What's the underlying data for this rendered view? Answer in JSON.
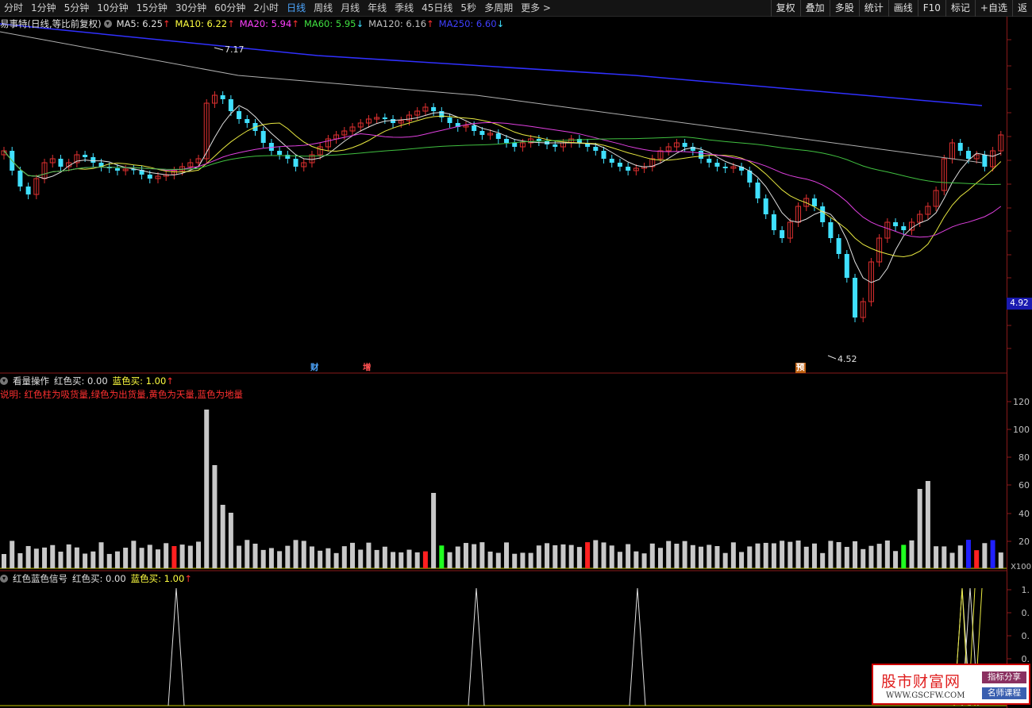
{
  "toolbar": {
    "periods": [
      "分时",
      "1分钟",
      "5分钟",
      "10分钟",
      "15分钟",
      "30分钟",
      "60分钟",
      "2小时",
      "日线",
      "周线",
      "月线",
      "年线",
      "季线",
      "45日线",
      "5秒",
      "多周期",
      "更多 >"
    ],
    "active_period": "日线",
    "actions": [
      "复权",
      "叠加",
      "多股",
      "统计",
      "画线",
      "F10",
      "标记",
      "+自选",
      "返"
    ]
  },
  "main_panel": {
    "stock": "易事特(日线,等比前复权)",
    "ma": [
      {
        "label": "MA5: 6.25",
        "arrow": "↑",
        "color": "#e0e0e0"
      },
      {
        "label": "MA10: 6.22",
        "arrow": "↑",
        "color": "#ffff40"
      },
      {
        "label": "MA20: 5.94",
        "arrow": "↑",
        "color": "#ff40ff"
      },
      {
        "label": "MA60: 5.95",
        "arrow": "↓",
        "color": "#40e040"
      },
      {
        "label": "MA120: 6.16",
        "arrow": "↑",
        "color": "#c0c0c0"
      },
      {
        "label": "MA250: 6.60",
        "arrow": "↓",
        "color": "#4040ff"
      }
    ],
    "high_label": "7.17",
    "low_label": "4.52",
    "current_price": "4.92",
    "events": [
      {
        "text": "财",
        "color": "#4da6ff"
      },
      {
        "text": "增",
        "color": "#ff5050"
      },
      {
        "text": "预",
        "color": "#ffa030"
      }
    ]
  },
  "volume_panel": {
    "title": "看量操作",
    "red_label": "红色买: 0.00",
    "blue_label": "蓝色买: 1.00",
    "blue_arrow": "↑",
    "note": "说明: 红色柱为吸货量,绿色为出货量,黄色为天量,蓝色为地量",
    "unit": "X100",
    "axis": [
      "120",
      "100",
      "80",
      "60",
      "40",
      "20"
    ]
  },
  "signal_panel": {
    "title": "红色蓝色信号",
    "red_label": "红色买: 0.00",
    "blue_label": "蓝色买: 1.00",
    "blue_arrow": "↑",
    "axis": [
      "1.",
      "0.",
      "0.",
      "0.",
      "0."
    ]
  },
  "watermark": {
    "title": "股市财富网",
    "url": "WWW.GSCFW.COM",
    "badge1": "指标分享",
    "badge2": "名师课程"
  }
}
